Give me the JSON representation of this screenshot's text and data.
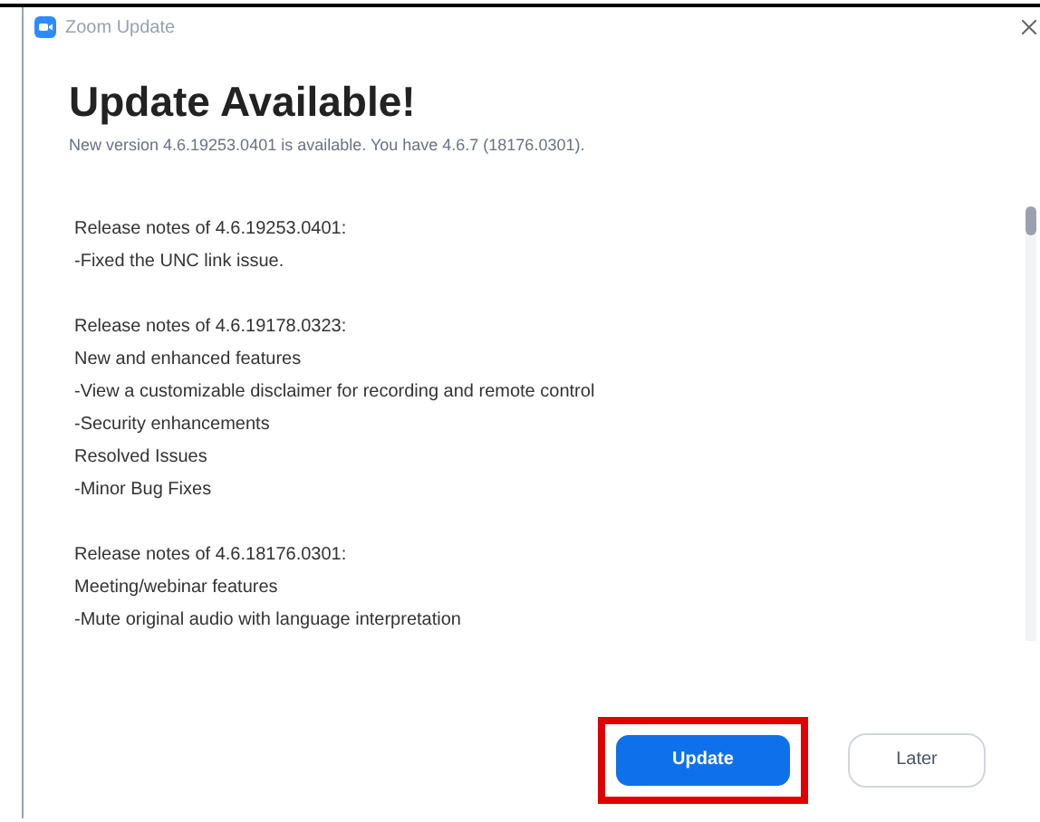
{
  "window": {
    "title": "Zoom Update"
  },
  "heading": "Update Available!",
  "subtitle": "New version 4.6.19253.0401 is available. You have 4.6.7 (18176.0301).",
  "release_notes": [
    {
      "heading": "Release notes of 4.6.19253.0401:",
      "lines": [
        "-Fixed the UNC link issue."
      ]
    },
    {
      "heading": "Release notes of 4.6.19178.0323:",
      "lines": [
        "New and enhanced features",
        "-View a customizable disclaimer for recording and remote control",
        "-Security enhancements",
        "Resolved Issues",
        "-Minor Bug Fixes"
      ]
    },
    {
      "heading": "Release notes of 4.6.18176.0301:",
      "lines": [
        "Meeting/webinar features",
        "-Mute original audio with language interpretation"
      ]
    }
  ],
  "buttons": [
    {
      "label": "Update",
      "kind": "primary",
      "highlighted": true
    },
    {
      "label": "Later",
      "kind": "secondary",
      "highlighted": false
    }
  ]
}
